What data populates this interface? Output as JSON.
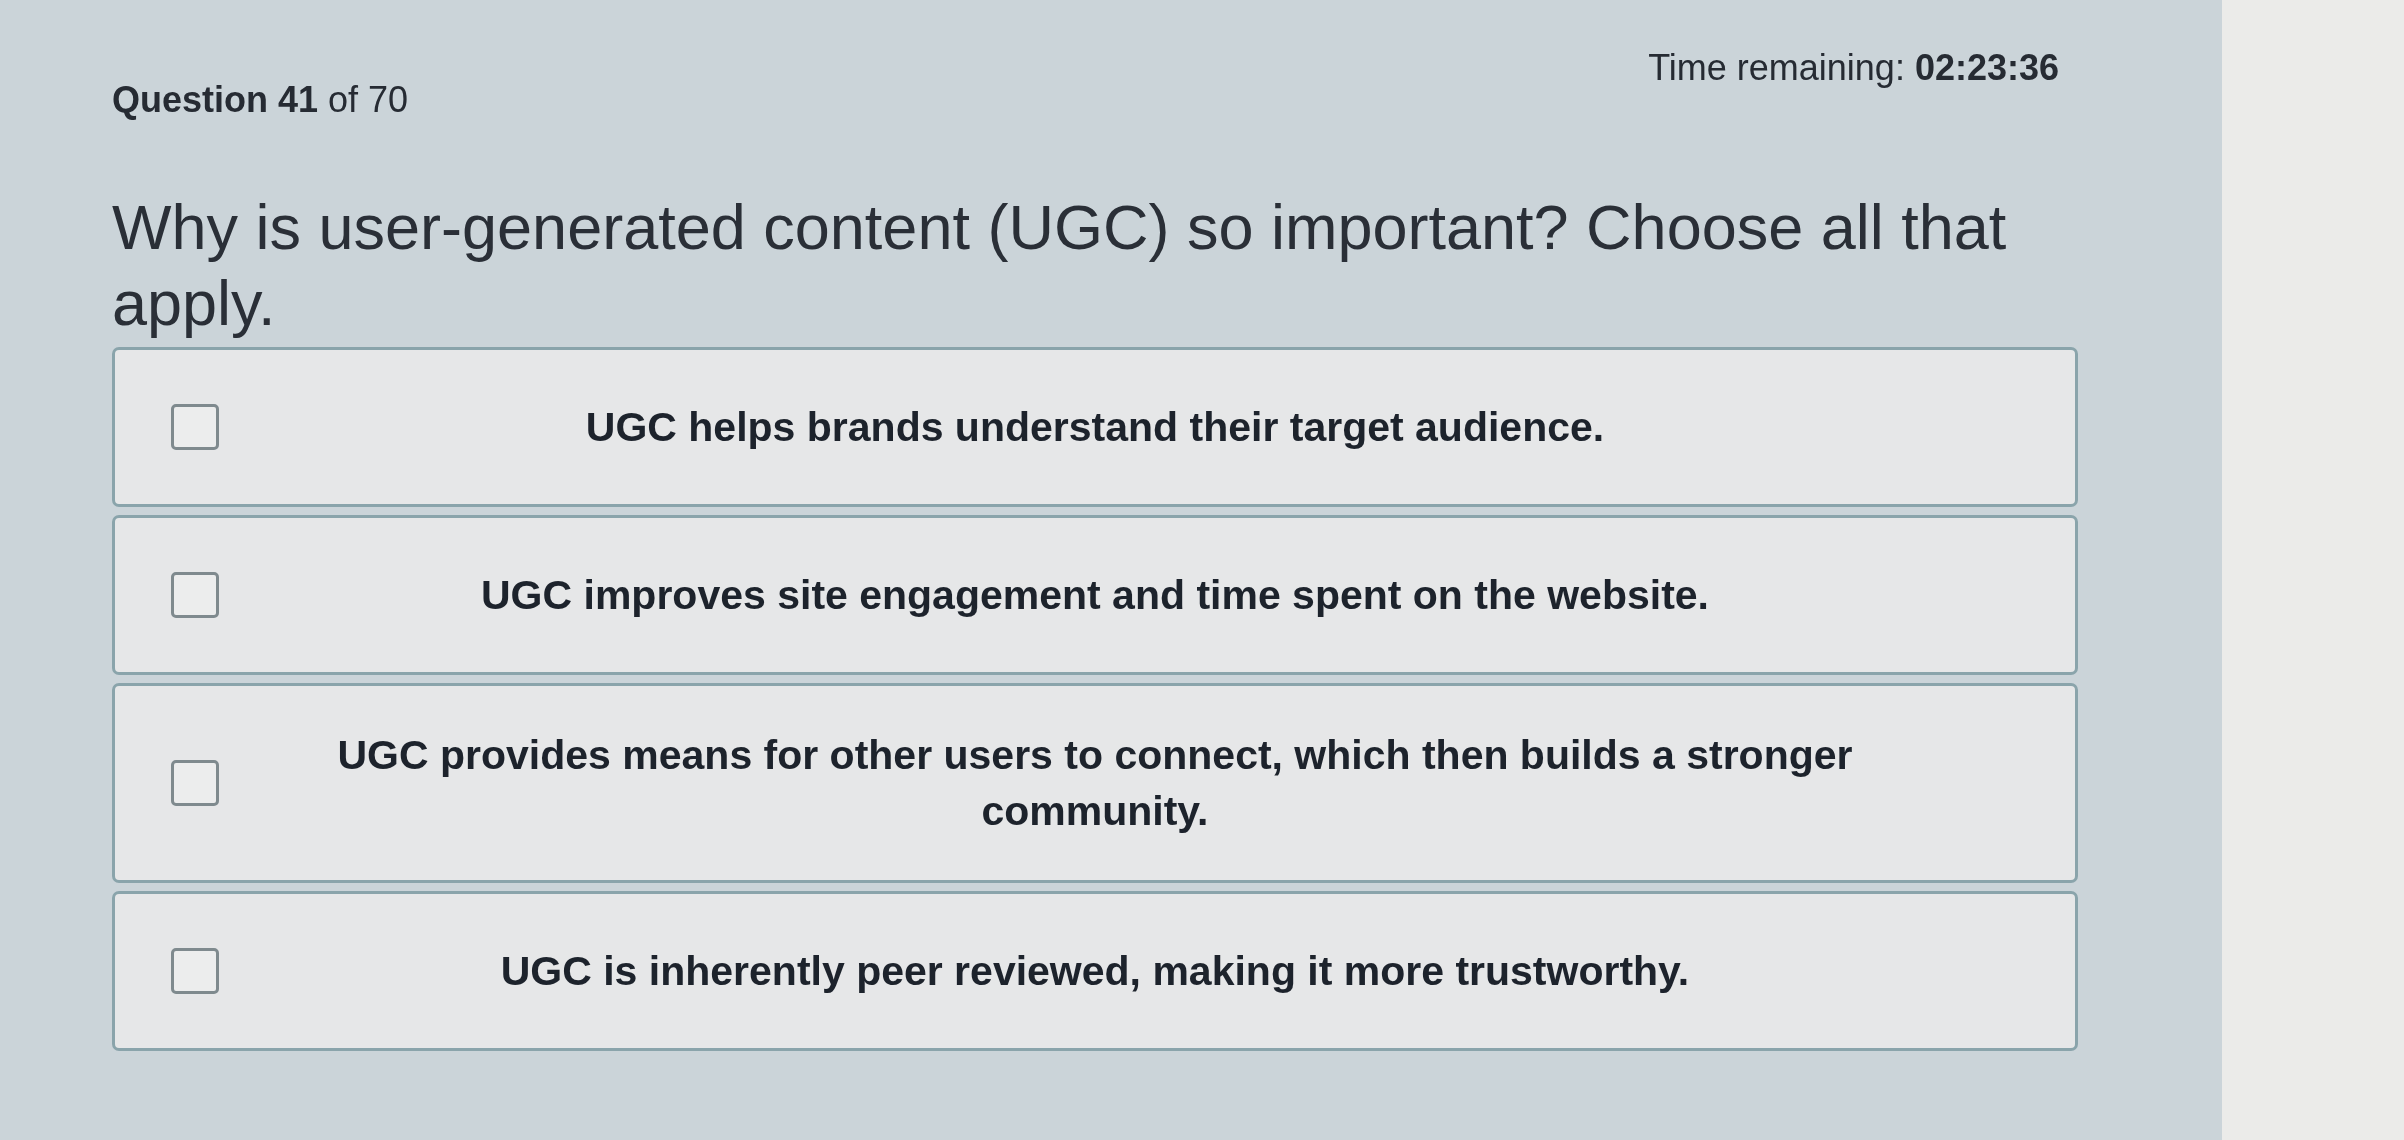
{
  "header": {
    "question_counter": "**Question 41** of 70",
    "time_remaining": "Time remaining: **02:23:36**"
  },
  "question": "Why is user-generated content (UGC) so important? Choose all that apply.",
  "options": [
    {
      "label": "UGC helps brands understand their target audience.",
      "checked": false
    },
    {
      "label": "UGC improves site engagement and time spent on the website.",
      "checked": false
    },
    {
      "label": "UGC provides means for other users to connect, which then builds a stronger community.",
      "checked": false
    },
    {
      "label": "UGC is inherently peer reviewed, making it more trustworthy.",
      "checked": false
    }
  ]
}
